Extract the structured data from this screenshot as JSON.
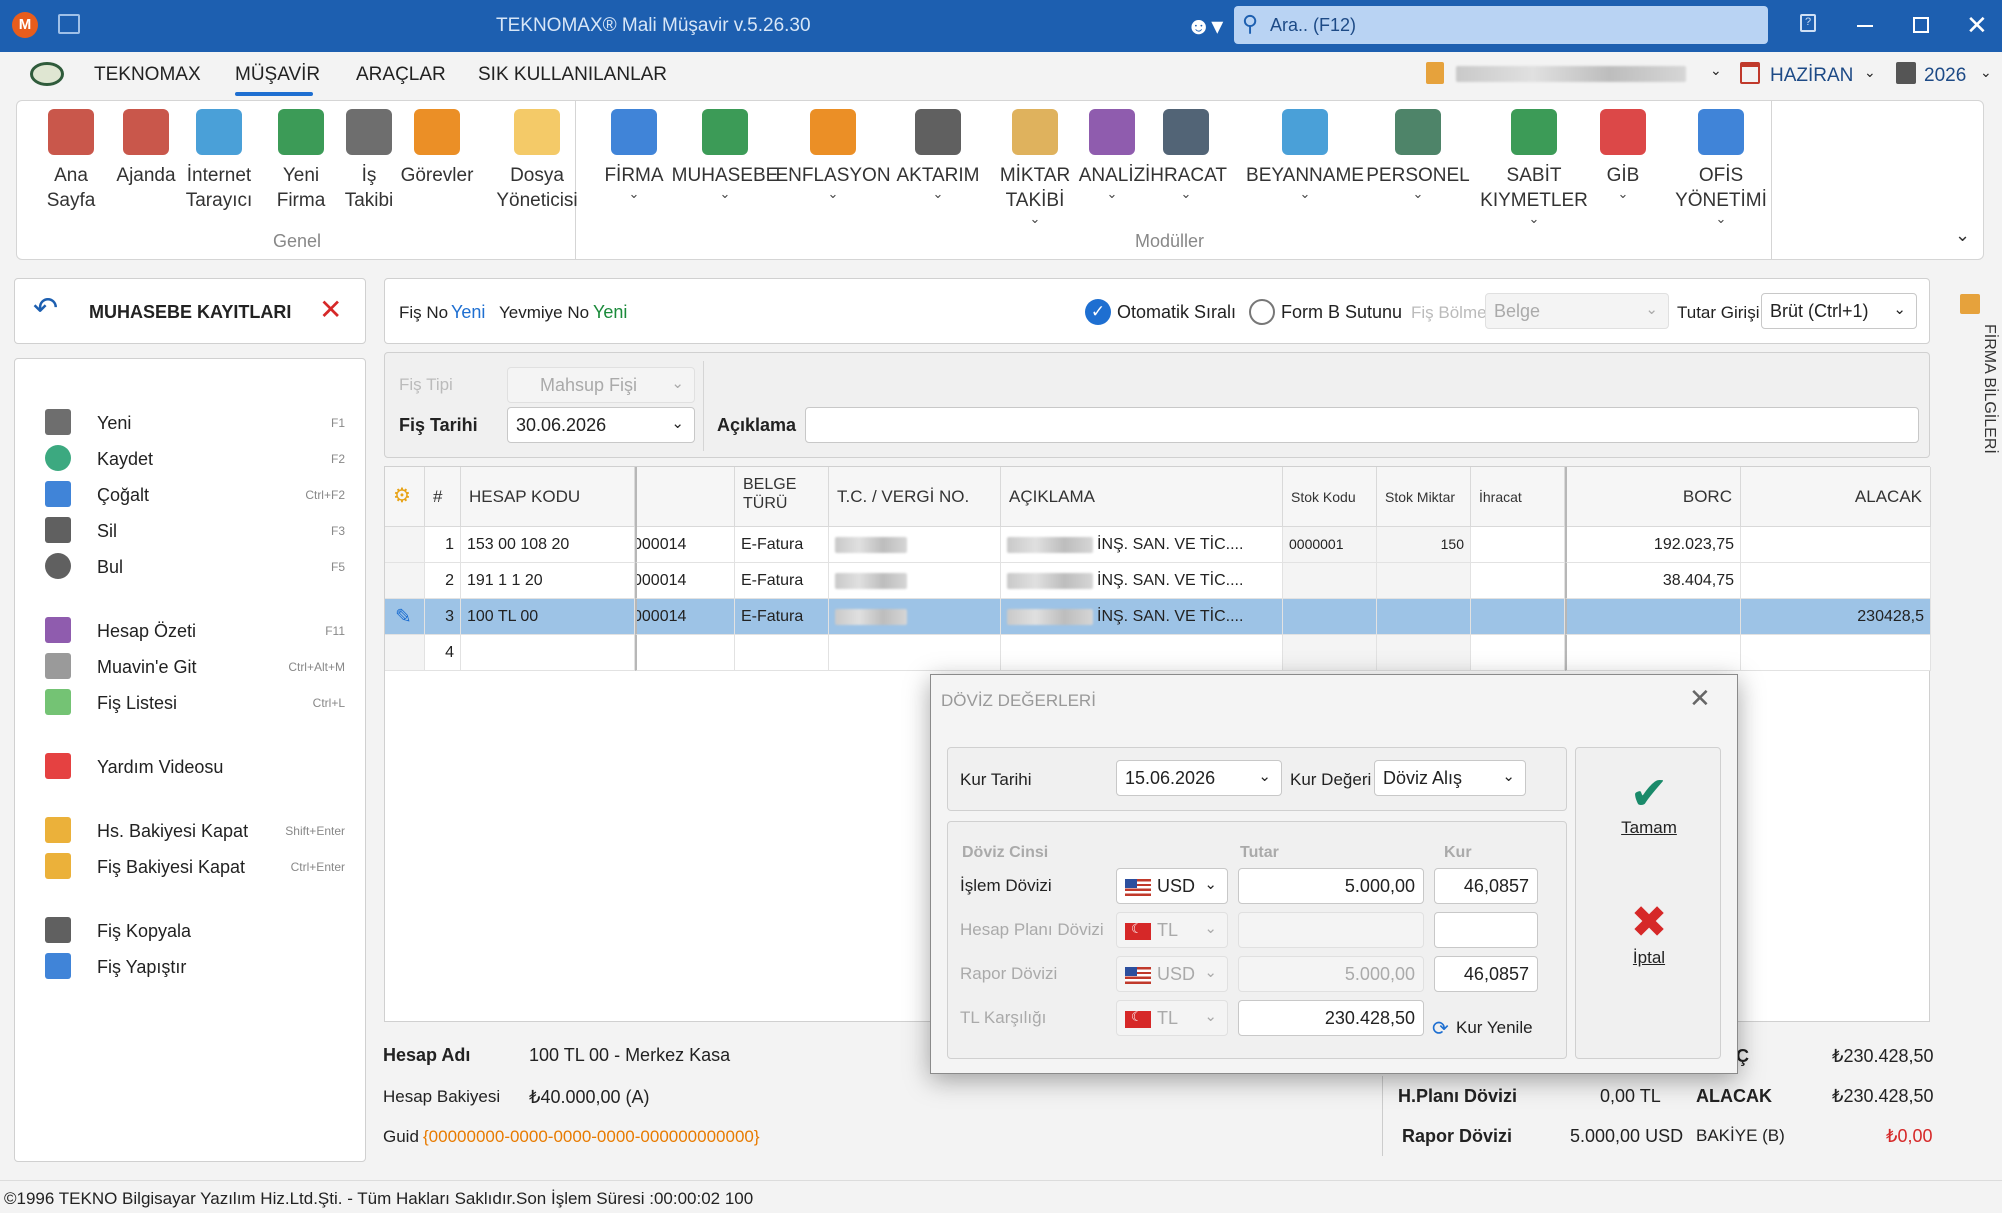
{
  "colors": {
    "titlebar": "#1d5fb0",
    "accent": "#1e6fd1",
    "green": "#1a8a3a",
    "orange": "#e87b00",
    "red": "#d62828",
    "selection": "#9dc3e6"
  },
  "titlebar": {
    "title": "TEKNOMAX® Mali Müşavir v.5.26.30",
    "search_placeholder": "Ara.. (F12)"
  },
  "menubar": {
    "items": [
      "TEKNOMAX",
      "MÜŞAVİR",
      "ARAÇLAR",
      "SIK KULLANILANLAR"
    ],
    "active": "MÜŞAVİR",
    "month": "HAZİRAN",
    "year": "2026"
  },
  "ribbon": {
    "general": [
      {
        "line1": "Ana",
        "line2": "Sayfa",
        "icon": "home-icon"
      },
      {
        "line1": "Ajanda",
        "line2": "",
        "icon": "calendar-icon"
      },
      {
        "line1": "İnternet",
        "line2": "Tarayıcı",
        "icon": "globe-icon"
      },
      {
        "line1": "Yeni",
        "line2": "Firma",
        "icon": "new-company-icon"
      },
      {
        "line1": "İş",
        "line2": "Takibi",
        "icon": "task-tracking-icon"
      },
      {
        "line1": "Görevler",
        "line2": "",
        "icon": "tasks-icon"
      },
      {
        "line1": "Dosya",
        "line2": "Yöneticisi",
        "icon": "folder-icon"
      }
    ],
    "general_label": "Genel",
    "modules": [
      {
        "line1": "FİRMA",
        "line2": "",
        "icon": "binders-icon"
      },
      {
        "line1": "MUHASEBE",
        "line2": "",
        "icon": "calculator-icon"
      },
      {
        "line1": "ENFLASYON",
        "line2": "",
        "icon": "inflation-chart-icon"
      },
      {
        "line1": "AKTARIM",
        "line2": "",
        "icon": "transfer-icon"
      },
      {
        "line1": "MİKTAR",
        "line2": "TAKİBİ",
        "icon": "box-icon"
      },
      {
        "line1": "ANALİZ",
        "line2": "",
        "icon": "bar-chart-icon"
      },
      {
        "line1": "İHRACAT",
        "line2": "",
        "icon": "ship-icon"
      },
      {
        "line1": "BEYANNAME",
        "line2": "",
        "icon": "declaration-icon"
      },
      {
        "line1": "PERSONEL",
        "line2": "",
        "icon": "personnel-icon"
      },
      {
        "line1": "SABİT",
        "line2": "KIYMETLER",
        "icon": "fixed-assets-icon"
      },
      {
        "line1": "GİB",
        "line2": "",
        "icon": "gib-icon"
      },
      {
        "line1": "OFİS",
        "line2": "YÖNETİMİ",
        "icon": "office-icon"
      }
    ],
    "modules_label": "Modüller"
  },
  "left": {
    "title": "MUHASEBE KAYITLARI",
    "items": [
      {
        "label": "Yeni",
        "shortcut": "F1",
        "icon": "new-document-icon"
      },
      {
        "label": "Kaydet",
        "shortcut": "F2",
        "icon": "check-circle-icon"
      },
      {
        "label": "Çoğalt",
        "shortcut": "Ctrl+F2",
        "icon": "duplicate-icon"
      },
      {
        "label": "Sil",
        "shortcut": "F3",
        "icon": "trash-icon"
      },
      {
        "label": "Bul",
        "shortcut": "F5",
        "icon": "search-icon"
      },
      {
        "label": "Hesap Özeti",
        "shortcut": "F11",
        "icon": "bar-chart-icon"
      },
      {
        "label": "Muavin'e Git",
        "shortcut": "Ctrl+Alt+M",
        "icon": "ledger-icon"
      },
      {
        "label": "Fiş Listesi",
        "shortcut": "Ctrl+L",
        "icon": "flag-icon"
      },
      {
        "label": "Yardım Videosu",
        "shortcut": "",
        "icon": "youtube-icon"
      },
      {
        "label": "Hs. Bakiyesi Kapat",
        "shortcut": "Shift+Enter",
        "icon": "magic-wand-icon"
      },
      {
        "label": "Fiş Bakiyesi Kapat",
        "shortcut": "Ctrl+Enter",
        "icon": "magic-wand-icon"
      },
      {
        "label": "Fiş Kopyala",
        "shortcut": "",
        "icon": "copy-icon"
      },
      {
        "label": "Fiş Yapıştır",
        "shortcut": "",
        "icon": "paste-icon"
      }
    ]
  },
  "header": {
    "fis_no_label": "Fiş No",
    "fis_no": "Yeni",
    "yevmiye_label": "Yevmiye No",
    "yevmiye": "Yeni",
    "auto_label": "Otomatik Sıralı",
    "formb_label": "Form B Sutunu",
    "fis_bolme_label": "Fiş Bölme",
    "fis_bolme": "Belge",
    "tutar_label": "Tutar Girişi",
    "tutar": "Brüt (Ctrl+1)",
    "fis_tipi_label": "Fiş Tipi",
    "fis_tipi": "Mahsup Fişi",
    "fis_tarihi_label": "Fiş Tarihi",
    "fis_tarihi": "30.06.2026",
    "aciklama_label": "Açıklama",
    "aciklama": ""
  },
  "grid": {
    "headers": [
      "#",
      "HESAP KODU",
      "",
      "BELGE TÜRÜ",
      "T.C. / VERGİ NO.",
      "AÇIKLAMA",
      "Stok Kodu",
      "Stok Miktar",
      "İhracat",
      "BORC",
      "ALACAK"
    ],
    "rows": [
      {
        "no": "1",
        "hesap": "153 00 108 20",
        "belge_no": "000014",
        "belge_turu": "E-Fatura",
        "aciklama": "İNŞ. SAN. VE TİC....",
        "stok_kodu": "0000001",
        "stok_miktar": "150",
        "borc": "192.023,75",
        "alacak": ""
      },
      {
        "no": "2",
        "hesap": "191 1 1 20",
        "belge_no": "000014",
        "belge_turu": "E-Fatura",
        "aciklama": "İNŞ. SAN. VE TİC....",
        "stok_kodu": "",
        "stok_miktar": "",
        "borc": "38.404,75",
        "alacak": ""
      },
      {
        "no": "3",
        "hesap": "100 TL 00",
        "belge_no": "000014",
        "belge_turu": "E-Fatura",
        "aciklama": "İNŞ. SAN. VE TİC....",
        "stok_kodu": "",
        "stok_miktar": "",
        "borc": "",
        "alacak": "230428,5"
      },
      {
        "no": "4",
        "hesap": "",
        "belge_no": "",
        "belge_turu": "",
        "aciklama": "",
        "stok_kodu": "",
        "stok_miktar": "",
        "borc": "",
        "alacak": ""
      }
    ]
  },
  "footer": {
    "hesap_adi_label": "Hesap Adı",
    "hesap_adi": "100 TL 00 - Merkez Kasa",
    "bakiye_label": "Hesap Bakiyesi",
    "bakiye": "₺40.000,00 (A)",
    "guid_label": "Guid",
    "guid": "{00000000-0000-0000-0000-000000000000}",
    "hplani_label": "H.Planı Dövizi",
    "hplani": "0,00 TL",
    "rapor_label": "Rapor Dövizi",
    "rapor": "5.000,00 USD",
    "borc_label": "Ç",
    "borc": "₺230.428,50",
    "alacak_label": "ALACAK",
    "alacak": "₺230.428,50",
    "bakiye2_label": "BAKİYE (B)",
    "bakiye2": "₺0,00"
  },
  "dialog": {
    "title": "DÖVİZ DEĞERLERİ",
    "kur_tarihi_label": "Kur Tarihi",
    "kur_tarihi": "15.06.2026",
    "kur_degeri_label": "Kur Değeri",
    "kur_degeri": "Döviz Alış",
    "col_doviz": "Döviz Cinsi",
    "col_tutar": "Tutar",
    "col_kur": "Kur",
    "rows": [
      {
        "label": "İşlem Dövizi",
        "currency": "USD",
        "tutar": "5.000,00",
        "kur": "46,0857"
      },
      {
        "label": "Hesap Planı Dövizi",
        "currency": "TL",
        "tutar": "",
        "kur": ""
      },
      {
        "label": "Rapor Dövizi",
        "currency": "USD",
        "tutar": "5.000,00",
        "kur": "46,0857"
      },
      {
        "label": "TL Karşılığı",
        "currency": "TL",
        "tutar": "230.428,50",
        "kur": ""
      }
    ],
    "kur_yenile": "Kur Yenile",
    "ok": "Tamam",
    "cancel": "İptal"
  },
  "side_tab": "FİRMA BİLGİLERİ",
  "status": {
    "copyright": "©1996 TEKNO Bilgisayar Yazılım Hiz.Ltd.Şti. - Tüm Hakları Saklıdır.",
    "last_op": "Son İşlem Süresi :00:00:02 100"
  }
}
